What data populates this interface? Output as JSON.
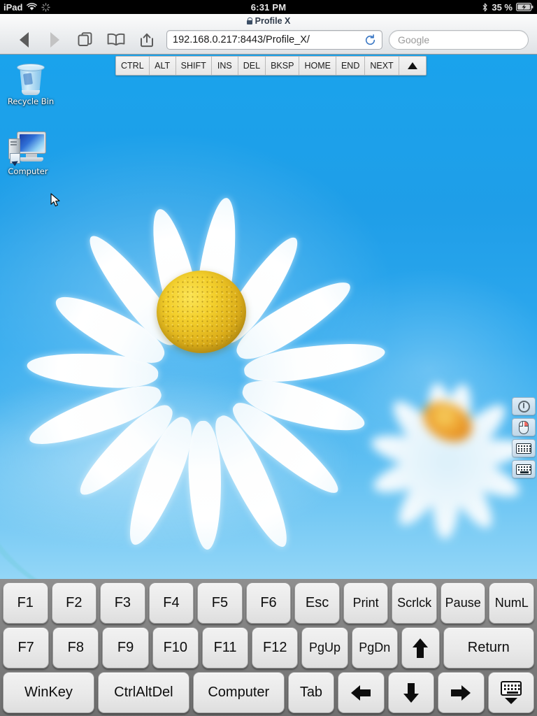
{
  "status_bar": {
    "device": "iPad",
    "wifi_icon": "wifi-icon",
    "activity_icon": "activity-spinner-icon",
    "time": "6:31 PM",
    "bluetooth_icon": "bluetooth-icon",
    "battery_percent": "35 %",
    "battery_icon": "battery-charging-icon"
  },
  "browser": {
    "tab_title": "Profile X",
    "lock_icon": "lock-icon",
    "back_label": "back-icon",
    "forward_label": "forward-icon",
    "tabs_label": "tabs-icon",
    "bookmarks_label": "bookmarks-icon",
    "share_label": "share-icon",
    "url": "192.168.0.217:8443/Profile_X/",
    "reload_icon": "reload-icon",
    "search_placeholder": "Google"
  },
  "modifier_bar": {
    "keys": [
      {
        "label": "CTRL"
      },
      {
        "label": "ALT"
      },
      {
        "label": "SHIFT"
      },
      {
        "label": "INS"
      },
      {
        "label": "DEL"
      },
      {
        "label": "BKSP"
      },
      {
        "label": "HOME"
      },
      {
        "label": "END"
      },
      {
        "label": "NEXT"
      },
      {
        "label": "▲",
        "icon": "up-triangle-icon"
      }
    ]
  },
  "desktop": {
    "icons": [
      {
        "label": "Recycle Bin",
        "icon": "recycle-bin-icon"
      },
      {
        "label": "Computer",
        "icon": "computer-icon"
      }
    ],
    "cursor_icon": "mouse-pointer-cursor",
    "wallpaper": "daisy-flower-wallpaper"
  },
  "side_tools": [
    {
      "icon": "power-icon",
      "name": "power-button"
    },
    {
      "icon": "mouse-icon",
      "name": "right-click-toggle"
    },
    {
      "icon": "keyboard-icon",
      "name": "keyboard-toggle"
    },
    {
      "icon": "keyboard-extended-icon",
      "name": "extended-keyboard-toggle"
    }
  ],
  "keyboard": {
    "rows": [
      [
        {
          "label": "F1"
        },
        {
          "label": "F2"
        },
        {
          "label": "F3"
        },
        {
          "label": "F4"
        },
        {
          "label": "F5"
        },
        {
          "label": "F6"
        },
        {
          "label": "Esc"
        },
        {
          "label": "Print"
        },
        {
          "label": "Scrlck"
        },
        {
          "label": "Pause"
        },
        {
          "label": "NumL"
        }
      ],
      [
        {
          "label": "F7"
        },
        {
          "label": "F8"
        },
        {
          "label": "F9"
        },
        {
          "label": "F10"
        },
        {
          "label": "F11"
        },
        {
          "label": "F12"
        },
        {
          "label": "PgUp"
        },
        {
          "label": "PgDn"
        },
        {
          "label": "⬆",
          "icon": "arrow-up-icon"
        },
        {
          "label": "Return"
        }
      ],
      [
        {
          "label": "WinKey"
        },
        {
          "label": "CtrlAltDel"
        },
        {
          "label": "Computer"
        },
        {
          "label": "Tab"
        },
        {
          "label": "⬅",
          "icon": "arrow-left-icon"
        },
        {
          "label": "⬇",
          "icon": "arrow-down-icon"
        },
        {
          "label": "➡",
          "icon": "arrow-right-icon"
        },
        {
          "label": "",
          "icon": "hide-keyboard-icon"
        }
      ]
    ]
  },
  "colors": {
    "desktop_blue": "#1f9ee8",
    "keyboard_bg": "#7e7e7e",
    "key_face": "#e9e9e9",
    "status_bar_bg": "#000000",
    "toolbar_bg": "#eceef0"
  }
}
